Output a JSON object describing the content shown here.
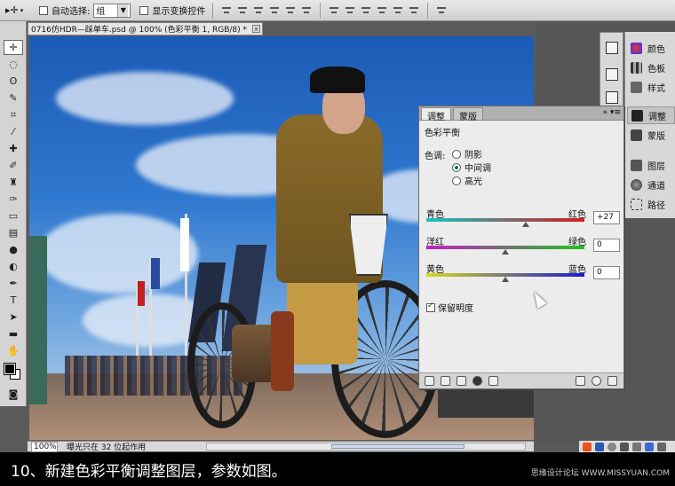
{
  "optbar": {
    "auto_select_label": "自动选择:",
    "auto_select_value": "组",
    "show_transform_label": "显示变换控件"
  },
  "document": {
    "tab_title": "0716仿HDR—踩单车.psd @ 100% (色彩平衡 1, RGB/8) *",
    "zoom": "100%",
    "status_text": "曝光只在 32 位起作用"
  },
  "dock": {
    "items": [
      {
        "label": "颜色",
        "icon": "color-icon"
      },
      {
        "label": "色板",
        "icon": "swatches-icon"
      },
      {
        "label": "样式",
        "icon": "styles-icon"
      },
      {
        "label": "调整",
        "icon": "adjustments-icon"
      },
      {
        "label": "蒙版",
        "icon": "masks-icon"
      },
      {
        "label": "图层",
        "icon": "layers-icon"
      },
      {
        "label": "通道",
        "icon": "channels-icon"
      },
      {
        "label": "路径",
        "icon": "paths-icon"
      }
    ]
  },
  "adjustments": {
    "tabs": [
      "调整",
      "蒙版"
    ],
    "active_tab": "调整",
    "title": "色彩平衡",
    "tone_label": "色调:",
    "tone_options": [
      "阴影",
      "中间调",
      "高光"
    ],
    "tone_selected": "中间调",
    "sliders": [
      {
        "left": "青色",
        "right": "红色",
        "value": "+27",
        "position": 0.63,
        "gradient": [
          "#19c2c2",
          "#d61b1b"
        ]
      },
      {
        "left": "洋红",
        "right": "绿色",
        "value": "0",
        "position": 0.5,
        "gradient": [
          "#c41fc4",
          "#1fc41f"
        ]
      },
      {
        "left": "黄色",
        "right": "蓝色",
        "value": "0",
        "position": 0.5,
        "gradient": [
          "#d8d81a",
          "#1a1ad8"
        ]
      }
    ],
    "preserve_luminosity": "保留明度"
  },
  "caption": {
    "text": "10、新建色彩平衡调整图层，参数如图。",
    "watermark": "思缘设计论坛 WWW.MISSYUAN.COM"
  }
}
